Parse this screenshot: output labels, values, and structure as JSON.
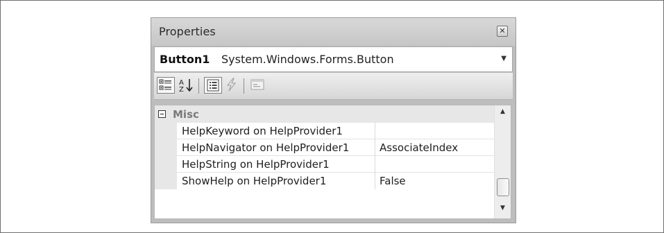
{
  "window": {
    "title": "Properties",
    "close_glyph": "✕"
  },
  "object_selector": {
    "name": "Button1",
    "type": "System.Windows.Forms.Button",
    "arrow": "▼"
  },
  "toolbar": {
    "buttons": [
      {
        "name": "categorized-icon"
      },
      {
        "name": "alphabetical-icon"
      },
      {
        "name": "properties-icon"
      },
      {
        "name": "events-icon"
      },
      {
        "name": "property-pages-icon"
      }
    ]
  },
  "grid": {
    "category": "Misc",
    "rows": [
      {
        "name": "HelpKeyword on HelpProvider1",
        "value": ""
      },
      {
        "name": "HelpNavigator on HelpProvider1",
        "value": "AssociateIndex"
      },
      {
        "name": "HelpString on HelpProvider1",
        "value": ""
      },
      {
        "name": "ShowHelp on HelpProvider1",
        "value": "False"
      }
    ]
  },
  "scrollbar": {
    "up_glyph": "▲",
    "down_glyph": "▼"
  }
}
